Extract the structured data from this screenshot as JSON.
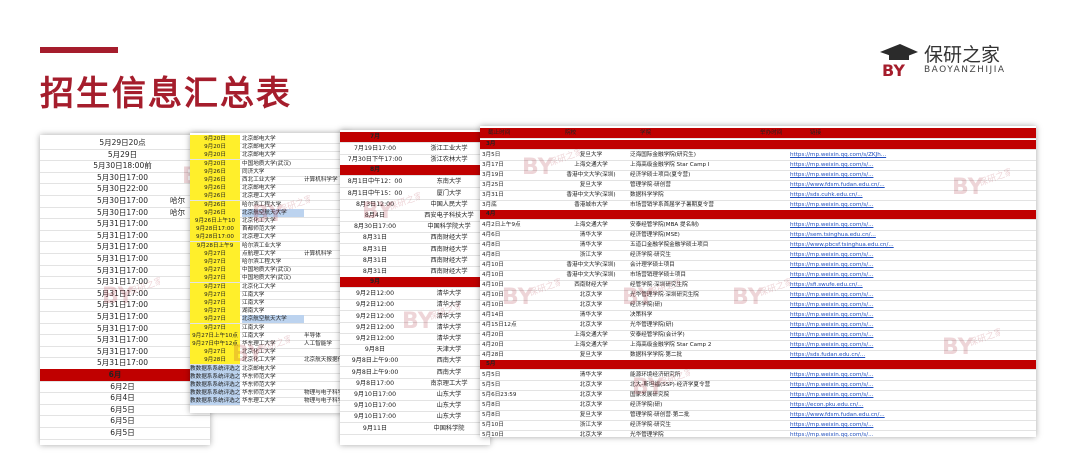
{
  "title": "招生信息汇总表",
  "logo": {
    "cn": "保研之家",
    "en": "BAOYANZHIJIA",
    "mark": "BY"
  },
  "colors": {
    "accent": "#a51d2c",
    "month_band": "#c00000",
    "yellow": "#ffef2b",
    "blue": "#bcd3ef",
    "link": "#1f4fbf"
  },
  "sheet1": {
    "rows": [
      "5月29日20点",
      "5月29日",
      "5月30日18:00前",
      "5月30日17:00",
      "5月30日22:00",
      "5月30日17:00",
      "5月30日17:00",
      "5月31日17:00",
      "5月31日17:00",
      "5月31日17:00",
      "5月31日17:00",
      "5月31日17:00",
      "5月31日17:00",
      "5月31日17:00",
      "5月31日17:00",
      "5月31日17:00",
      "5月31日17:00",
      "5月31日17:00",
      "5月31日17:00",
      "5月31日17:00",
      "6月",
      "6月2日",
      "6月4日",
      "6月5日",
      "6月5日",
      "6月5日"
    ],
    "side": [
      "",
      "",
      "",
      "",
      "",
      "哈尔",
      "哈尔",
      "",
      "",
      "",
      "",
      "",
      "",
      "",
      "",
      "",
      "",
      "",
      "",
      "",
      "",
      "",
      "",
      "",
      "",
      ""
    ]
  },
  "sheet2": {
    "dates": [
      "9月20日",
      "9月20日",
      "9月20日",
      "9月20日",
      "9月26日",
      "9月26日",
      "9月26日",
      "9月26日",
      "9月26日",
      "9月26日",
      "9月26日上午10",
      "9月28日17:00",
      "9月28日17:00",
      "9月28日上午9",
      "9月27日",
      "9月27日",
      "9月27日",
      "9月27日",
      "9月27日",
      "9月27日",
      "9月27日",
      "9月27日",
      "9月27日",
      "9月27日",
      "9月27日上午10点",
      "9月27日中午12点",
      "9月27日",
      "9月28日",
      "教数据系系统评选之",
      "教数据系系统评选之",
      "教数据系系统评选之",
      "教数据系系统评选之",
      "教数据系系统评选之"
    ],
    "schools": [
      "北京邮电大学",
      "北京邮电大学",
      "北京邮电大学",
      "中国地质大学(武汉)",
      "同济大学",
      "西北工业大学",
      "北京邮电大学",
      "北京理工大学",
      "哈尔滨工程大学",
      "北京航空航天大学",
      "北京化工大学",
      "首都师范大学",
      "北京理工大学",
      "哈尔滨工业大学",
      "点航理工大学",
      "哈尔滨工程大学",
      "中国地质大学(武汉)",
      "中国地质大学(武汉)",
      "北京化工大学",
      "江南大学",
      "江南大学",
      "湖南大学",
      "北京航空航天大学",
      "江南大学",
      "江南大学",
      "华东理工大学",
      "北京化工大学",
      "北京化工大学",
      "北京邮电大学",
      "华东师范大学",
      "华东师范大学",
      "华东师范大学",
      "华东理工大学",
      "山西大学"
    ],
    "notes": [
      "",
      "",
      "",
      "",
      "",
      "计算机科学学",
      "",
      "",
      "",
      "",
      "",
      "",
      "",
      "",
      "计算机科学",
      "",
      "",
      "",
      "",
      "",
      "",
      "",
      "",
      "",
      "半导体",
      "人工智能学",
      "",
      "北京航天报据传",
      "",
      "",
      "",
      "物理与电子科学",
      "物理与电子科学",
      "",
      ""
    ]
  },
  "sheet3": {
    "months": {
      "m7": "7月",
      "m8": "8月",
      "m9": "9月"
    },
    "rows": [
      {
        "d": "7月19日17:00",
        "s": "浙江工业大学"
      },
      {
        "d": "7月30日下午17:00",
        "s": "浙江农林大学"
      },
      {
        "d": "8月1日中午12：00",
        "s": "东南大学"
      },
      {
        "d": "8月1日中午15：00",
        "s": "厦门大学"
      },
      {
        "d": "8月3日12:00",
        "s": "中国人民大学"
      },
      {
        "d": "8月4日",
        "s": "西安电子科技大学"
      },
      {
        "d": "8月30日17:00",
        "s": "中国科学院大学"
      },
      {
        "d": "8月31日",
        "s": "西南财经大学"
      },
      {
        "d": "8月31日",
        "s": "西南财经大学"
      },
      {
        "d": "8月31日",
        "s": "西南财经大学"
      },
      {
        "d": "8月31日",
        "s": "西南财经大学"
      },
      {
        "d": "9月2日12:00",
        "s": "清华大学"
      },
      {
        "d": "9月2日12:00",
        "s": "清华大学"
      },
      {
        "d": "9月2日12:00",
        "s": "清华大学"
      },
      {
        "d": "9月2日12:00",
        "s": "清华大学"
      },
      {
        "d": "9月2日12:00",
        "s": "清华大学"
      },
      {
        "d": "9月8日",
        "s": "天津大学"
      },
      {
        "d": "9月8日上午9:00",
        "s": "西南大学"
      },
      {
        "d": "9月8日上午9:00",
        "s": "西南大学"
      },
      {
        "d": "9月8日17:00",
        "s": "南京理工大学"
      },
      {
        "d": "9月10日17:00",
        "s": "山东大学"
      },
      {
        "d": "9月10日17:00",
        "s": "山东大学"
      },
      {
        "d": "9月10日17:00",
        "s": "山东大学"
      },
      {
        "d": "9月11日",
        "s": "中国科学院"
      }
    ]
  },
  "sheet4": {
    "header": [
      "截止时间",
      "院校",
      "学院",
      "举办时间",
      "链接"
    ],
    "months": {
      "m3": "3月",
      "m4": "4月",
      "m5": "5月"
    },
    "rows": [
      {
        "d": "3月5日",
        "s": "复旦大学",
        "c": "泛海国际金融学院(研究生)",
        "l": "https://mp.weixin.qq.com/s/ZKJh..."
      },
      {
        "d": "3月17日",
        "s": "上海交通大学",
        "c": "上海高级金融学院 Star Camp I",
        "l": "https://mp.weixin.qq.com/s/..."
      },
      {
        "d": "3月19日",
        "s": "香港中文大学(深圳)",
        "c": "经济学硕士项目(夏令营)",
        "l": "https://mp.weixin.qq.com/s/..."
      },
      {
        "d": "3月25日",
        "s": "复旦大学",
        "c": "管理学院·研创营",
        "l": "https://www.fdsm.fudan.edu.cn/..."
      },
      {
        "d": "3月31日",
        "s": "香港中文大学(深圳)",
        "c": "数据科学学院",
        "l": "https://sds.cuhk.edu.cn/..."
      },
      {
        "d": "3月底",
        "s": "香港城市大学",
        "c": "市场营销学系首届学子暑期夏令营",
        "l": "https://mp.weixin.qq.com/s/..."
      },
      {
        "d": "4月2日上午9点",
        "s": "上海交通大学",
        "c": "安泰经管学院(MBA 提名制)",
        "l": "https://mp.weixin.qq.com/s/..."
      },
      {
        "d": "4月6日",
        "s": "清华大学",
        "c": "经济管理学院(MSE)",
        "l": "https://sem.tsinghua.edu.cn/..."
      },
      {
        "d": "4月8日",
        "s": "清华大学",
        "c": "五道口金融学院金融学硕士项目",
        "l": "https://www.pbcsf.tsinghua.edu.cn/..."
      },
      {
        "d": "4月8日",
        "s": "浙江大学",
        "c": "经济学院·研究生",
        "l": "https://mp.weixin.qq.com/s/..."
      },
      {
        "d": "4月10日",
        "s": "香港中文大学(深圳)",
        "c": "会计理学硕士项目",
        "l": "https://mp.weixin.qq.com/s/..."
      },
      {
        "d": "4月10日",
        "s": "香港中文大学(深圳)",
        "c": "市场营销理学硕士项目",
        "l": "https://mp.weixin.qq.com/s/..."
      },
      {
        "d": "4月10日",
        "s": "西南财经大学",
        "c": "经管学院·深圳研究生院",
        "l": "https://sfi.swufe.edu.cn/..."
      },
      {
        "d": "4月10日",
        "s": "北京大学",
        "c": "光华管理学院·深圳研究生院",
        "l": "https://mp.weixin.qq.com/s/..."
      },
      {
        "d": "4月10日",
        "s": "北京大学",
        "c": "经济学院(研)",
        "l": "https://mp.weixin.qq.com/s/..."
      },
      {
        "d": "4月14日",
        "s": "清华大学",
        "c": "决策科学",
        "l": "https://mp.weixin.qq.com/s/..."
      },
      {
        "d": "4月15日12点",
        "s": "北京大学",
        "c": "光华管理学院(研)",
        "l": "https://mp.weixin.qq.com/s/..."
      },
      {
        "d": "4月20日",
        "s": "上海交通大学",
        "c": "安泰经管学院(会计学)",
        "l": "https://mp.weixin.qq.com/s/..."
      },
      {
        "d": "4月20日",
        "s": "上海交通大学",
        "c": "上海高级金融学院 Star Camp 2",
        "l": "https://mp.weixin.qq.com/s/..."
      },
      {
        "d": "4月28日",
        "s": "复旦大学",
        "c": "数据科学学院·第二批",
        "l": "https://sds.fudan.edu.cn/..."
      },
      {
        "d": "5月5日",
        "s": "清华大学",
        "c": "能源环境经济研究所",
        "l": "https://mp.weixin.qq.com/s/..."
      },
      {
        "d": "5月5日",
        "s": "北京大学",
        "c": "北大-斯坦福(SSP)·经济学夏令营",
        "l": "https://mp.weixin.qq.com/s/..."
      },
      {
        "d": "5月6日23:59",
        "s": "北京大学",
        "c": "国家发展研究院",
        "l": "https://mp.weixin.qq.com/s/..."
      },
      {
        "d": "5月8日",
        "s": "北京大学",
        "c": "经济学院(研)",
        "l": "https://econ.pku.edu.cn/..."
      },
      {
        "d": "5月8日",
        "s": "复旦大学",
        "c": "管理学院·研创营·第二批",
        "l": "https://www.fdsm.fudan.edu.cn/..."
      },
      {
        "d": "5月10日",
        "s": "浙江大学",
        "c": "经济学院·研究生",
        "l": "https://mp.weixin.qq.com/s/..."
      },
      {
        "d": "5月10日",
        "s": "北京大学",
        "c": "光华管理学院",
        "l": "https://mp.weixin.qq.com/s/..."
      }
    ]
  }
}
